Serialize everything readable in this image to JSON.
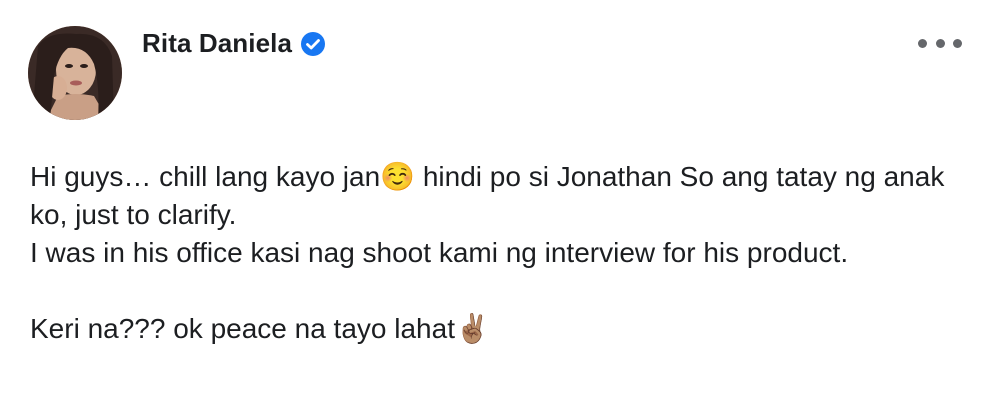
{
  "post": {
    "author": {
      "name": "Rita Daniela",
      "verified": true,
      "verified_color": "#1877f2"
    },
    "menu_icon": "more-horizontal-icon",
    "body": {
      "line1_a": "Hi guys… chill lang kayo jan",
      "emoji_smile": "☺️",
      "line1_b": " hindi po si Jonathan So ang tatay ng anak ko, just to clarify.",
      "line2": "I was in his office kasi nag shoot kami ng interview for his product.",
      "line3": "Keri na??? ok peace na tayo lahat",
      "emoji_peace": "✌🏽"
    }
  }
}
